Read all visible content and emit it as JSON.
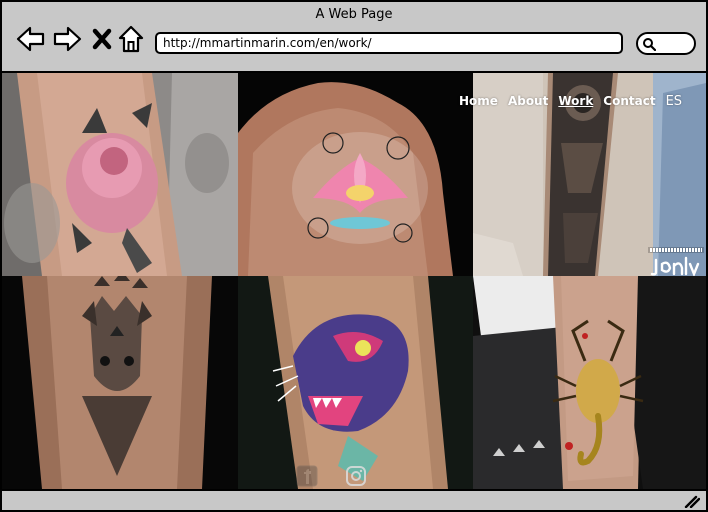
{
  "window": {
    "title": "A Web Page"
  },
  "toolbar": {
    "back_icon": "arrow-left-icon",
    "forward_icon": "arrow-right-icon",
    "stop_icon": "close-icon",
    "home_icon": "home-icon",
    "url": "http://mmartinmarin.com/en/work/",
    "search_icon": "search-icon"
  },
  "site_nav": {
    "items": [
      {
        "label": "Home",
        "active": false
      },
      {
        "label": "About",
        "active": false
      },
      {
        "label": "Work",
        "active": true
      },
      {
        "label": "Contact",
        "active": false
      }
    ],
    "language": "ES"
  },
  "logo": {
    "top_text": "MMARTINMARIN",
    "main_text": "Jonly"
  },
  "gallery": {
    "tiles": [
      {
        "subject": "pink rose forearm tattoo",
        "colors": [
          "#b7a59a",
          "#d98aa6"
        ]
      },
      {
        "subject": "lotus flower back tattoo",
        "colors": [
          "#b07a62",
          "#f08ab2"
        ]
      },
      {
        "subject": "mandala sleeve tattoo",
        "colors": [
          "#c9b9a8",
          "#2b2b2b"
        ]
      },
      {
        "subject": "geometric cat tattoo",
        "colors": [
          "#a87a60",
          "#3a3a3a"
        ]
      },
      {
        "subject": "panther head tattoo",
        "colors": [
          "#b28a6c",
          "#5a4aa8"
        ]
      },
      {
        "subject": "scorpion tattoo",
        "colors": [
          "#c9a08a",
          "#d8b040"
        ]
      }
    ]
  },
  "social": {
    "facebook_icon": "facebook-icon",
    "instagram_icon": "instagram-icon"
  },
  "colors": {
    "chrome": "#c8c8c8",
    "nav_text": "#ffffff",
    "page_bg": "#000000"
  }
}
